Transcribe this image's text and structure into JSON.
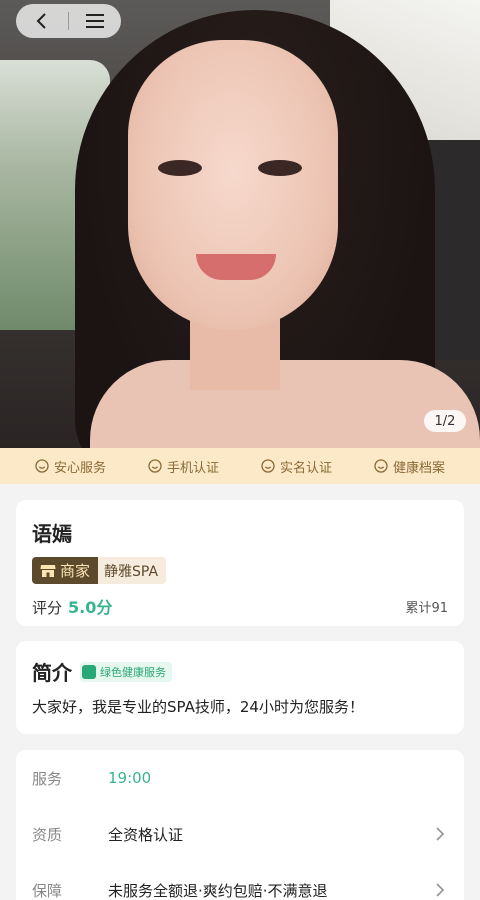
{
  "hero": {
    "photo_counter": "1/2"
  },
  "nav": {
    "back_icon": "chevron-left-icon",
    "menu_icon": "hamburger-menu-icon"
  },
  "guarantees": [
    {
      "label": "安心服务"
    },
    {
      "label": "手机认证"
    },
    {
      "label": "实名认证"
    },
    {
      "label": "健康档案"
    }
  ],
  "profile": {
    "name": "语嫣",
    "merchant_tag": "商家",
    "shop_name": "静雅SPA",
    "rating_label": "评分",
    "rating_value": "5.0分",
    "total": "累计91"
  },
  "intro": {
    "title": "简介",
    "badge": "绿色健康服务",
    "text": "大家好，我是专业的SPA技师，24小时为您服务！"
  },
  "details": {
    "service_label": "服务",
    "service_value": "19:00",
    "qualification_label": "资质",
    "qualification_value": "全资格认证",
    "guarantee_label": "保障",
    "guarantee_value": "未服务全额退·爽约包赔·不满意退"
  },
  "colors": {
    "accent_green": "#38b491",
    "strip_bg": "#fbe9c8",
    "strip_text": "#8a6a36",
    "merchant_brown": "#5d4a2c"
  }
}
